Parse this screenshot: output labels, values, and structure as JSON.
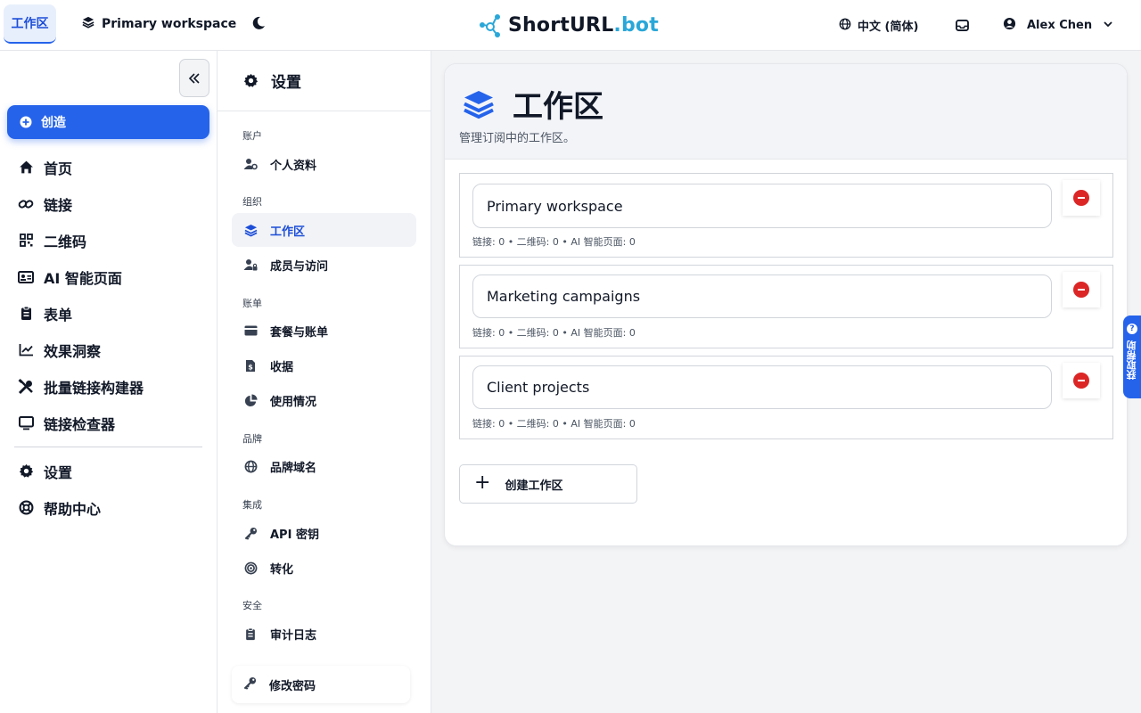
{
  "topbar": {
    "workspace_tab": "工作区",
    "workspace_switcher": "Primary workspace",
    "theme_icon": "moon-icon",
    "logo": {
      "main": "ShortURL",
      "accent": ".bot"
    },
    "language": "中文 (简体)",
    "user_name": "Alex Chen"
  },
  "leftnav": {
    "create_label": "创造",
    "items": [
      {
        "label": "首页",
        "icon": "home-icon"
      },
      {
        "label": "链接",
        "icon": "link-icon"
      },
      {
        "label": "二维码",
        "icon": "qrcode-icon"
      },
      {
        "label": "AI 智能页面",
        "icon": "id-card-icon"
      },
      {
        "label": "表单",
        "icon": "clipboard-icon"
      },
      {
        "label": "效果洞察",
        "icon": "chart-line-icon"
      },
      {
        "label": "批量链接构建器",
        "icon": "tools-icon"
      },
      {
        "label": "链接检查器",
        "icon": "monitor-icon"
      }
    ],
    "bottom_items": [
      {
        "label": "设置",
        "icon": "gear-icon"
      },
      {
        "label": "帮助中心",
        "icon": "lifebuoy-icon"
      }
    ]
  },
  "settings": {
    "title": "设置",
    "groups": {
      "account": "账户",
      "org": "组织",
      "billing": "账单",
      "brand": "品牌",
      "integration": "集成",
      "security": "安全"
    },
    "items": {
      "profile": "个人资料",
      "workspace": "工作区",
      "members": "成员与访问",
      "plans": "套餐与账单",
      "receipts": "收据",
      "usage": "使用情况",
      "domains": "品牌域名",
      "api": "API 密钥",
      "conversion": "转化",
      "audit": "审计日志",
      "password": "修改密码"
    }
  },
  "main": {
    "title": "工作区",
    "description": "管理订阅中的工作区。",
    "workspaces": [
      {
        "name": "Primary workspace",
        "stats": "链接: 0 • 二维码: 0 • AI 智能页面: 0"
      },
      {
        "name": "Marketing campaigns",
        "stats": "链接: 0 • 二维码: 0 • AI 智能页面: 0"
      },
      {
        "name": "Client projects",
        "stats": "链接: 0 • 二维码: 0 • AI 智能页面: 0"
      }
    ],
    "create_button": "创建工作区"
  },
  "help_tab": "获取帮助",
  "colors": {
    "primary": "#2563eb",
    "accent": "#2aa7d8",
    "danger": "#dc2626"
  }
}
